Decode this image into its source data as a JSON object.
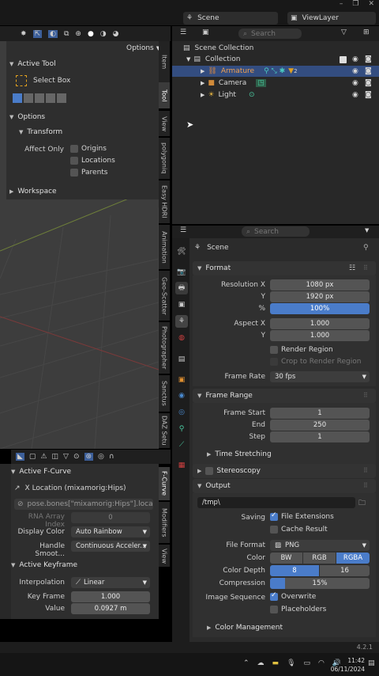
{
  "topbar": {
    "scene_label": "Scene",
    "viewlayer_label": "ViewLayer"
  },
  "left_header": {
    "options_label": "Options"
  },
  "tool_panel": {
    "active_tool_title": "Active Tool",
    "tool_name": "Select Box",
    "options_title": "Options",
    "transform_title": "Transform",
    "affect_only_label": "Affect Only",
    "origins_label": "Origins",
    "locations_label": "Locations",
    "parents_label": "Parents",
    "workspace_title": "Workspace"
  },
  "side_tabs_top": [
    "Item",
    "Tool",
    "View",
    "polygoniq",
    "Easy HDRI",
    "Animation",
    "Geo-Scatter",
    "Photographer",
    "Sanctus",
    "DAZ Setu"
  ],
  "side_tabs_bottom": [
    "F-Curve",
    "Modifiers",
    "View"
  ],
  "outliner": {
    "search_placeholder": "Search",
    "scene_collection": "Scene Collection",
    "collection": "Collection",
    "items": [
      "Armature",
      "Camera",
      "Light"
    ],
    "armature_badge": "2"
  },
  "properties": {
    "search_placeholder": "Search",
    "scene_title": "Scene",
    "format_title": "Format",
    "resolution_x_label": "Resolution X",
    "resolution_x": "1080 px",
    "y_label": "Y",
    "resolution_y": "1920 px",
    "percent_label": "%",
    "percent": "100%",
    "aspect_x_label": "Aspect X",
    "aspect_x": "1.000",
    "aspect_y": "1.000",
    "render_region": "Render Region",
    "crop_region": "Crop to Render Region",
    "frame_rate_label": "Frame Rate",
    "frame_rate": "30 fps",
    "frame_range_title": "Frame Range",
    "frame_start_label": "Frame Start",
    "frame_start": "1",
    "end_label": "End",
    "frame_end": "250",
    "step_label": "Step",
    "step": "1",
    "time_stretching": "Time Stretching",
    "stereoscopy": "Stereoscopy",
    "output_title": "Output",
    "output_path": "/tmp\\",
    "saving_label": "Saving",
    "file_extensions": "File Extensions",
    "cache_result": "Cache Result",
    "file_format_label": "File Format",
    "file_format": "PNG",
    "color_label": "Color",
    "color_options": [
      "BW",
      "RGB",
      "RGBA"
    ],
    "color_depth_label": "Color Depth",
    "color_depth_options": [
      "8",
      "16"
    ],
    "compression_label": "Compression",
    "compression": "15%",
    "compression_fraction": 0.15,
    "image_sequence_label": "Image Sequence",
    "overwrite": "Overwrite",
    "placeholders": "Placeholders",
    "color_management": "Color Management"
  },
  "graph_panel": {
    "active_fcurve_title": "Active F-Curve",
    "fcurve_name": "X Location (mixamorig:Hips)",
    "data_path": "pose.bones[\"mixamorig:Hips\"].loca...",
    "rna_label": "RNA Array Index",
    "rna_value": "0",
    "display_color_label": "Display Color",
    "display_color": "Auto Rainbow",
    "handle_smooth_label": "Handle Smoot...",
    "handle_smooth": "Continuous Acceler...",
    "active_keyframe_title": "Active Keyframe",
    "interpolation_label": "Interpolation",
    "interpolation": "Linear",
    "key_frame_label": "Key Frame",
    "key_frame": "1.000",
    "value_label": "Value",
    "value": "0.0927 m"
  },
  "status": {
    "version": "4.2.1"
  },
  "taskbar": {
    "time": "11:42",
    "date": "06/11/2024"
  },
  "colors": {
    "accent_blue": "#4a7cc9",
    "selection_blue": "#334d80",
    "panel": "#2b2b2b"
  }
}
